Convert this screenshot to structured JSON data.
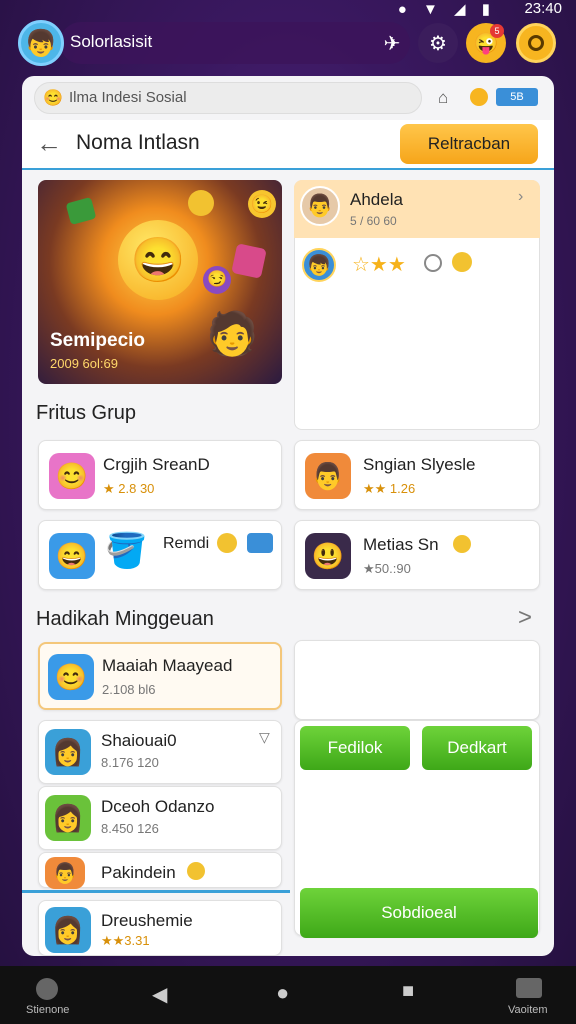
{
  "status": {
    "time": "23:40",
    "icons": "● ▼ ◢ ▮"
  },
  "topbar": {
    "avatar": "👦",
    "title": "Solorlasisit",
    "icons": [
      "rocket-icon",
      "gear-icon",
      "emoji-icon",
      "coin-icon"
    ],
    "notif_badge": "5"
  },
  "search": {
    "placeholder": "Ilma Indesi Sosial",
    "right_icons": [
      "home-icon",
      "coin-icon",
      "calendar-icon"
    ],
    "right_text": "5B"
  },
  "header": {
    "title": "Noma Intlasn",
    "action_label": "Reltracban"
  },
  "banner": {
    "title": "Semipecio",
    "subtitle": "2009 6ol:69"
  },
  "profile": {
    "name": "Ahdela",
    "sub": "5 / 60 60",
    "stars_text": "☆★★"
  },
  "group_section": {
    "title": "Fritus Grup"
  },
  "group_tiles": [
    {
      "title": "Crgjih SreanD",
      "sub": "★ 2.8 30",
      "icon": "😊"
    },
    {
      "title": "Sngian Slyesle",
      "sub": "★★ 1.26",
      "icon": "👨"
    },
    {
      "title": "Remdi",
      "sub": "",
      "icon": "😄"
    },
    {
      "title": "Metias Sn",
      "sub": "★50.:90",
      "icon": "😃"
    }
  ],
  "weekly_section": {
    "title": "Hadikah Minggeuan",
    "more": ">"
  },
  "weekly_list": [
    {
      "title": "Maaiah Maayead",
      "sub": "2.108 bl6",
      "icon": "😊"
    },
    {
      "title": "Shaiouai0",
      "sub": "8.176 120",
      "icon": "👩"
    },
    {
      "title": "Dceoh Odanzo",
      "sub": "8.450 126",
      "icon": "👩"
    },
    {
      "title": "Pakindein",
      "sub": "",
      "icon": "👨"
    },
    {
      "title": "Dreushemie",
      "sub": "★★3.31",
      "icon": "👩"
    }
  ],
  "weekly_side_buttons": {
    "left": "Fedilok",
    "right": "Dedkart",
    "bottom": "Sobdioeal"
  },
  "nav": {
    "left_label": "Stienone",
    "right_label": "Vaoitem",
    "back": "◀",
    "home": "●",
    "recent": "■"
  }
}
